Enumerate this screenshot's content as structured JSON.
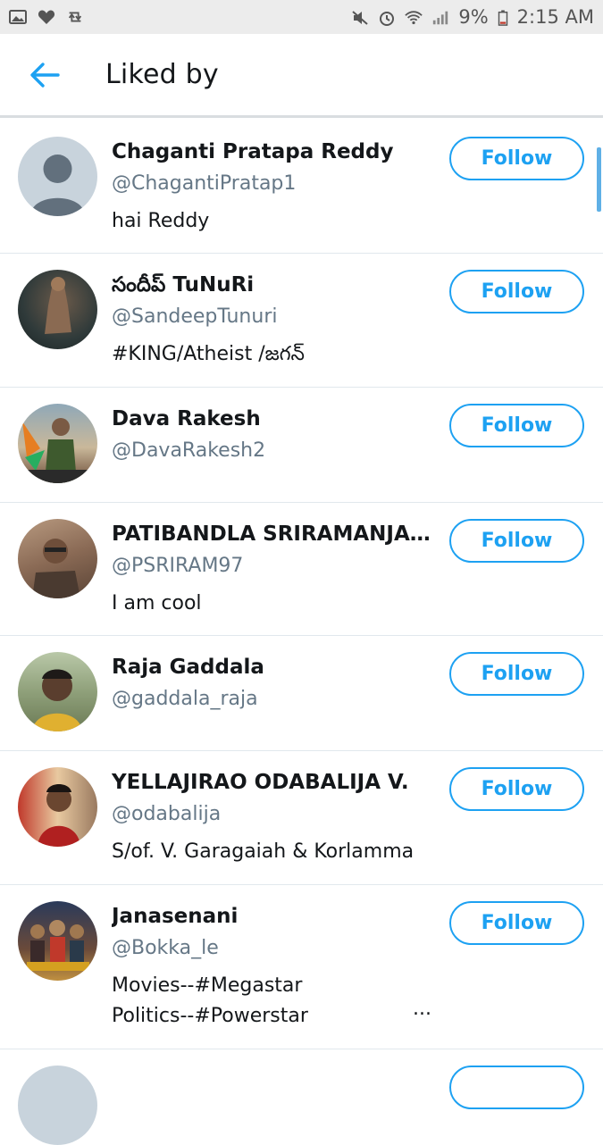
{
  "status_bar": {
    "battery": "9%",
    "time": "2:15 AM",
    "icons_left": [
      "image-icon",
      "heart-icon",
      "retweet-icon"
    ],
    "icons_right": [
      "mute-icon",
      "alarm-icon",
      "wifi-icon",
      "signal-icon",
      "battery-icon"
    ]
  },
  "header": {
    "title": "Liked by",
    "back_icon": "arrow-left-icon"
  },
  "colors": {
    "accent": "#1da1f2",
    "secondary_text": "#657786",
    "divider": "#e1e8ed"
  },
  "users": [
    {
      "name": "Chaganti Pratapa Reddy",
      "handle": "@ChagantiPratap1",
      "bio": "hai Reddy",
      "follow_label": "Follow",
      "avatar": "default-avatar"
    },
    {
      "name": "సందీప్ TuNuRi",
      "handle": "@SandeepTunuri",
      "bio": "#KING/Atheist /జగన్",
      "follow_label": "Follow",
      "avatar": "photo-avatar"
    },
    {
      "name": "Dava Rakesh",
      "handle": "@DavaRakesh2",
      "bio": "",
      "follow_label": "Follow",
      "avatar": "photo-avatar"
    },
    {
      "name": "PATIBANDLA SRIRAMANJANEY...",
      "handle": "@PSRIRAM97",
      "bio": "I am cool",
      "follow_label": "Follow",
      "avatar": "photo-avatar"
    },
    {
      "name": "Raja Gaddala",
      "handle": "@gaddala_raja",
      "bio": "",
      "follow_label": "Follow",
      "avatar": "photo-avatar"
    },
    {
      "name": "YELLAJIRAO ODABALIJA V.",
      "handle": "@odabalija",
      "bio": "S/of. V. Garagaiah & Korlamma",
      "follow_label": "Follow",
      "avatar": "photo-avatar"
    },
    {
      "name": "Janasenani",
      "handle": "@Bokka_le",
      "bio_lines": [
        "Movies--#Megastar",
        "Politics--#Powerstar"
      ],
      "bio_ellipsis": "...",
      "follow_label": "Follow",
      "avatar": "photo-avatar"
    }
  ]
}
